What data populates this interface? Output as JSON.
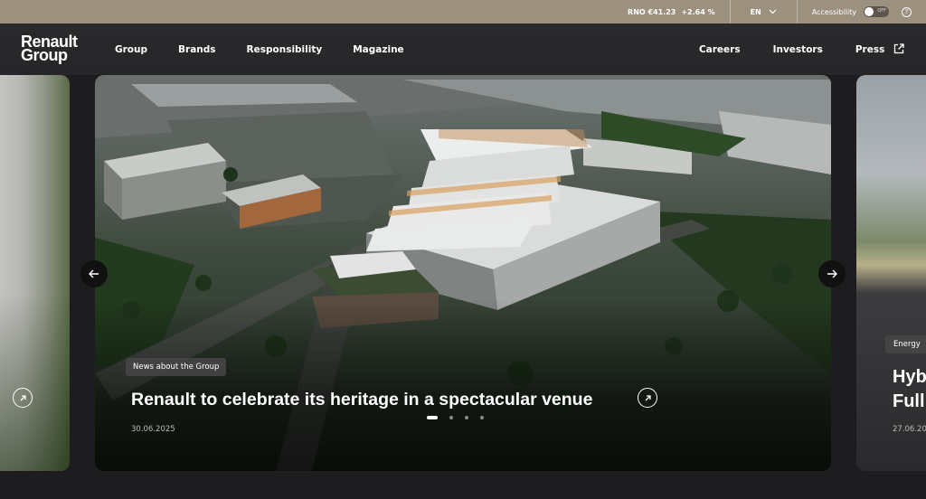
{
  "topbar": {
    "stock_label": "RNO €41.23",
    "stock_change": "+2.64 %",
    "language": "EN",
    "accessibility_label": "Accessibility",
    "toggle_state": "OFF",
    "help_icon": "?"
  },
  "logo": {
    "line1": "Renault",
    "line2": "Group"
  },
  "nav": {
    "left": [
      "Group",
      "Brands",
      "Responsibility",
      "Magazine"
    ],
    "right": [
      "Careers",
      "Investors",
      "Press"
    ]
  },
  "carousel": {
    "main": {
      "tag": "News about the Group",
      "headline": "Renault to celebrate its heritage in a spectacular venue",
      "date": "30.06.2025"
    },
    "next": {
      "tag": "Energy",
      "title_line1": "Hyb",
      "title_line2": "Full",
      "date": "27.06.20"
    },
    "dots_total": 4,
    "active_dot": 1
  }
}
